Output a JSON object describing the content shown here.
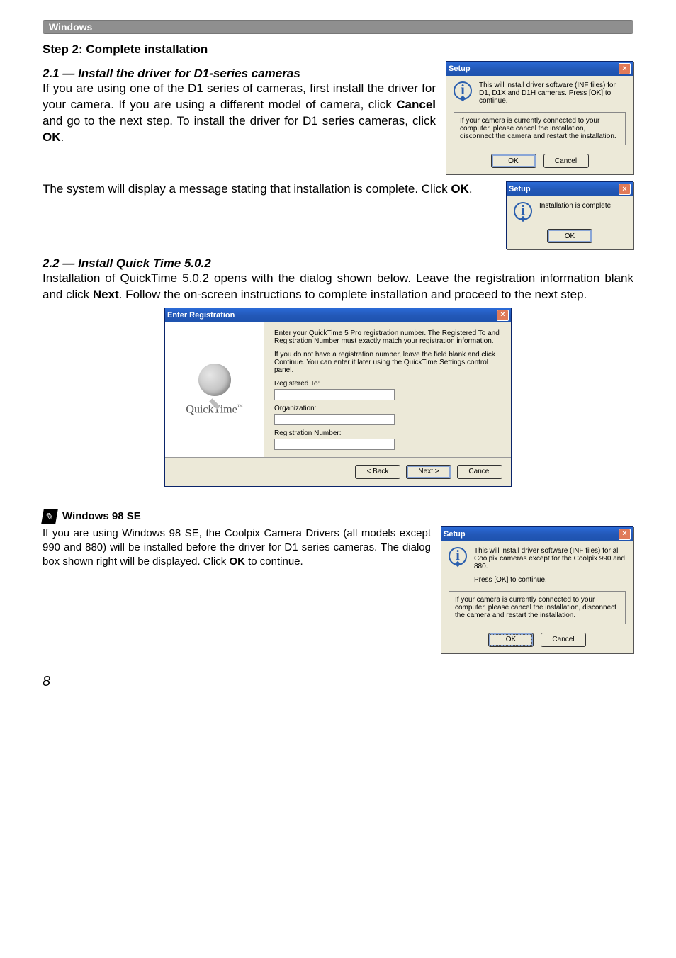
{
  "banner": "Windows",
  "step_title": "Step 2: Complete installation",
  "sub21_title": "2.1 — Install the driver for D1-series cameras",
  "sub21_body_a": "If you are using one of the D1 series of cameras, first install the driver for your camera.  If you are using a different model of camera, click ",
  "sub21_body_b": " and go to the next step.  To install the driver for D1 series cameras, click ",
  "cancel_bold": "Cancel",
  "ok_bold": "OK",
  "period": ".",
  "setup1": {
    "title": "Setup",
    "msg": "This will install driver software (INF files) for D1, D1X and D1H cameras. Press [OK] to continue.",
    "inset": "If your camera is currently connected to your computer, please cancel the installation, disconnect the camera and restart the installation.",
    "ok": "OK",
    "cancel": "Cancel"
  },
  "mid_para_a": "The system will display a message stating that installation is complete.  Click ",
  "setup2": {
    "title": "Setup",
    "msg": "Installation is complete.",
    "ok": "OK"
  },
  "sub22_title": "2.2 — Install Quick Time 5.0.2",
  "sub22_body_a": "Installation of QuickTime 5.0.2 opens with the dialog shown below.  Leave the registration information blank and click ",
  "next_bold": "Next",
  "sub22_body_b": ".  Follow the on-screen instructions to complete installation and proceed to the next step.",
  "qtdlg": {
    "title": "Enter Registration",
    "brand": "QuickTime",
    "tm": "™",
    "para1": "Enter your QuickTime 5 Pro registration number. The Registered To and Registration Number must exactly match your registration information.",
    "para2": "If you do not have a registration number, leave the field blank and click Continue. You can enter it later using the QuickTime Settings control panel.",
    "lbl_registered": "Registered To:",
    "lbl_org": "Organization:",
    "lbl_regnum": "Registration Number:",
    "back": "< Back",
    "next": "Next >",
    "cancel": "Cancel"
  },
  "callout_label": "Windows 98 SE",
  "callout_body_a": "If you are using Windows 98 SE, the Coolpix Camera Drivers (all models except 990 and 880) will be installed before the driver for D1 series cameras.  The dialog box shown right will be displayed.  Click ",
  "callout_body_b": " to continue.",
  "setup3": {
    "title": "Setup",
    "msg1": "This will install driver software (INF files) for all Coolpix cameras except for the Coolpix 990 and 880.",
    "msg2": "Press [OK] to continue.",
    "inset": "If your camera is currently connected to your computer, please cancel the installation, disconnect the camera and restart the installation.",
    "ok": "OK",
    "cancel": "Cancel"
  },
  "page_number": "8"
}
